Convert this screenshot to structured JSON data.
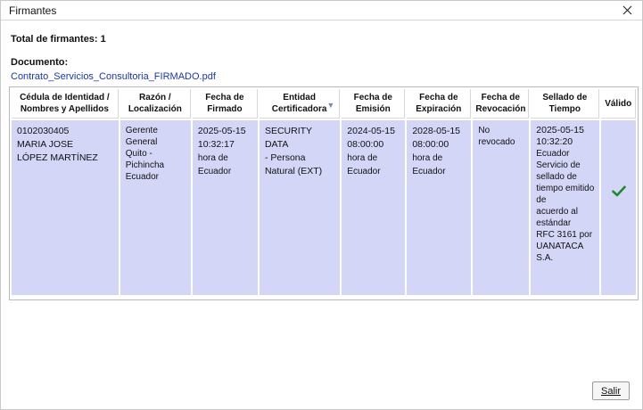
{
  "window": {
    "title": "Firmantes",
    "close_icon": "close-icon"
  },
  "summary": {
    "total_label": "Total de firmantes: 1",
    "document_label": "Documento:",
    "document_link": "Contrato_Servicios_Consultoria_FIRMADO.pdf"
  },
  "table": {
    "headers": [
      {
        "line1": "Cédula de Identidad /",
        "line2": "Nombres y Apellidos"
      },
      {
        "line1": "Razón /",
        "line2": "Localización"
      },
      {
        "line1": "Fecha de",
        "line2": "Firmado"
      },
      {
        "line1": "Entidad",
        "line2": "Certificadora",
        "sort_icon": "sort-descending-icon"
      },
      {
        "line1": "Fecha de",
        "line2": "Emisión"
      },
      {
        "line1": "Fecha de",
        "line2": "Expiración"
      },
      {
        "line1": "Fecha de",
        "line2": "Revocación"
      },
      {
        "line1": "Sellado de",
        "line2": "Tiempo"
      },
      {
        "line1": "Válido",
        "line2": ""
      }
    ],
    "rows": [
      {
        "identity": [
          "0102030405",
          "MARIA JOSE",
          "LÓPEZ MARTÍNEZ"
        ],
        "reason": [
          "Gerente General",
          "Quito - Pichincha",
          "Ecuador"
        ],
        "signed_date": [
          "2025-05-15",
          "10:32:17",
          "hora de Ecuador"
        ],
        "authority": [
          "SECURITY DATA",
          "- Persona",
          "Natural (EXT)"
        ],
        "issue_date": [
          "2024-05-15",
          "08:00:00",
          "hora de",
          "Ecuador"
        ],
        "expiry_date": [
          "2028-05-15",
          "08:00:00",
          "hora de",
          "Ecuador"
        ],
        "revocation": [
          "No revocado"
        ],
        "timestamp": [
          "2025-05-15",
          "10:32:20",
          "Ecuador",
          "Servicio de",
          "sellado de",
          "tiempo emitido de",
          "acuerdo al",
          "estándar",
          "RFC 3161 por",
          "UANATACA",
          "S.A."
        ],
        "valid_icon": "checkmark-icon",
        "valid_color": "#1e8a2e"
      }
    ]
  },
  "footer": {
    "exit_label": "Salir"
  }
}
